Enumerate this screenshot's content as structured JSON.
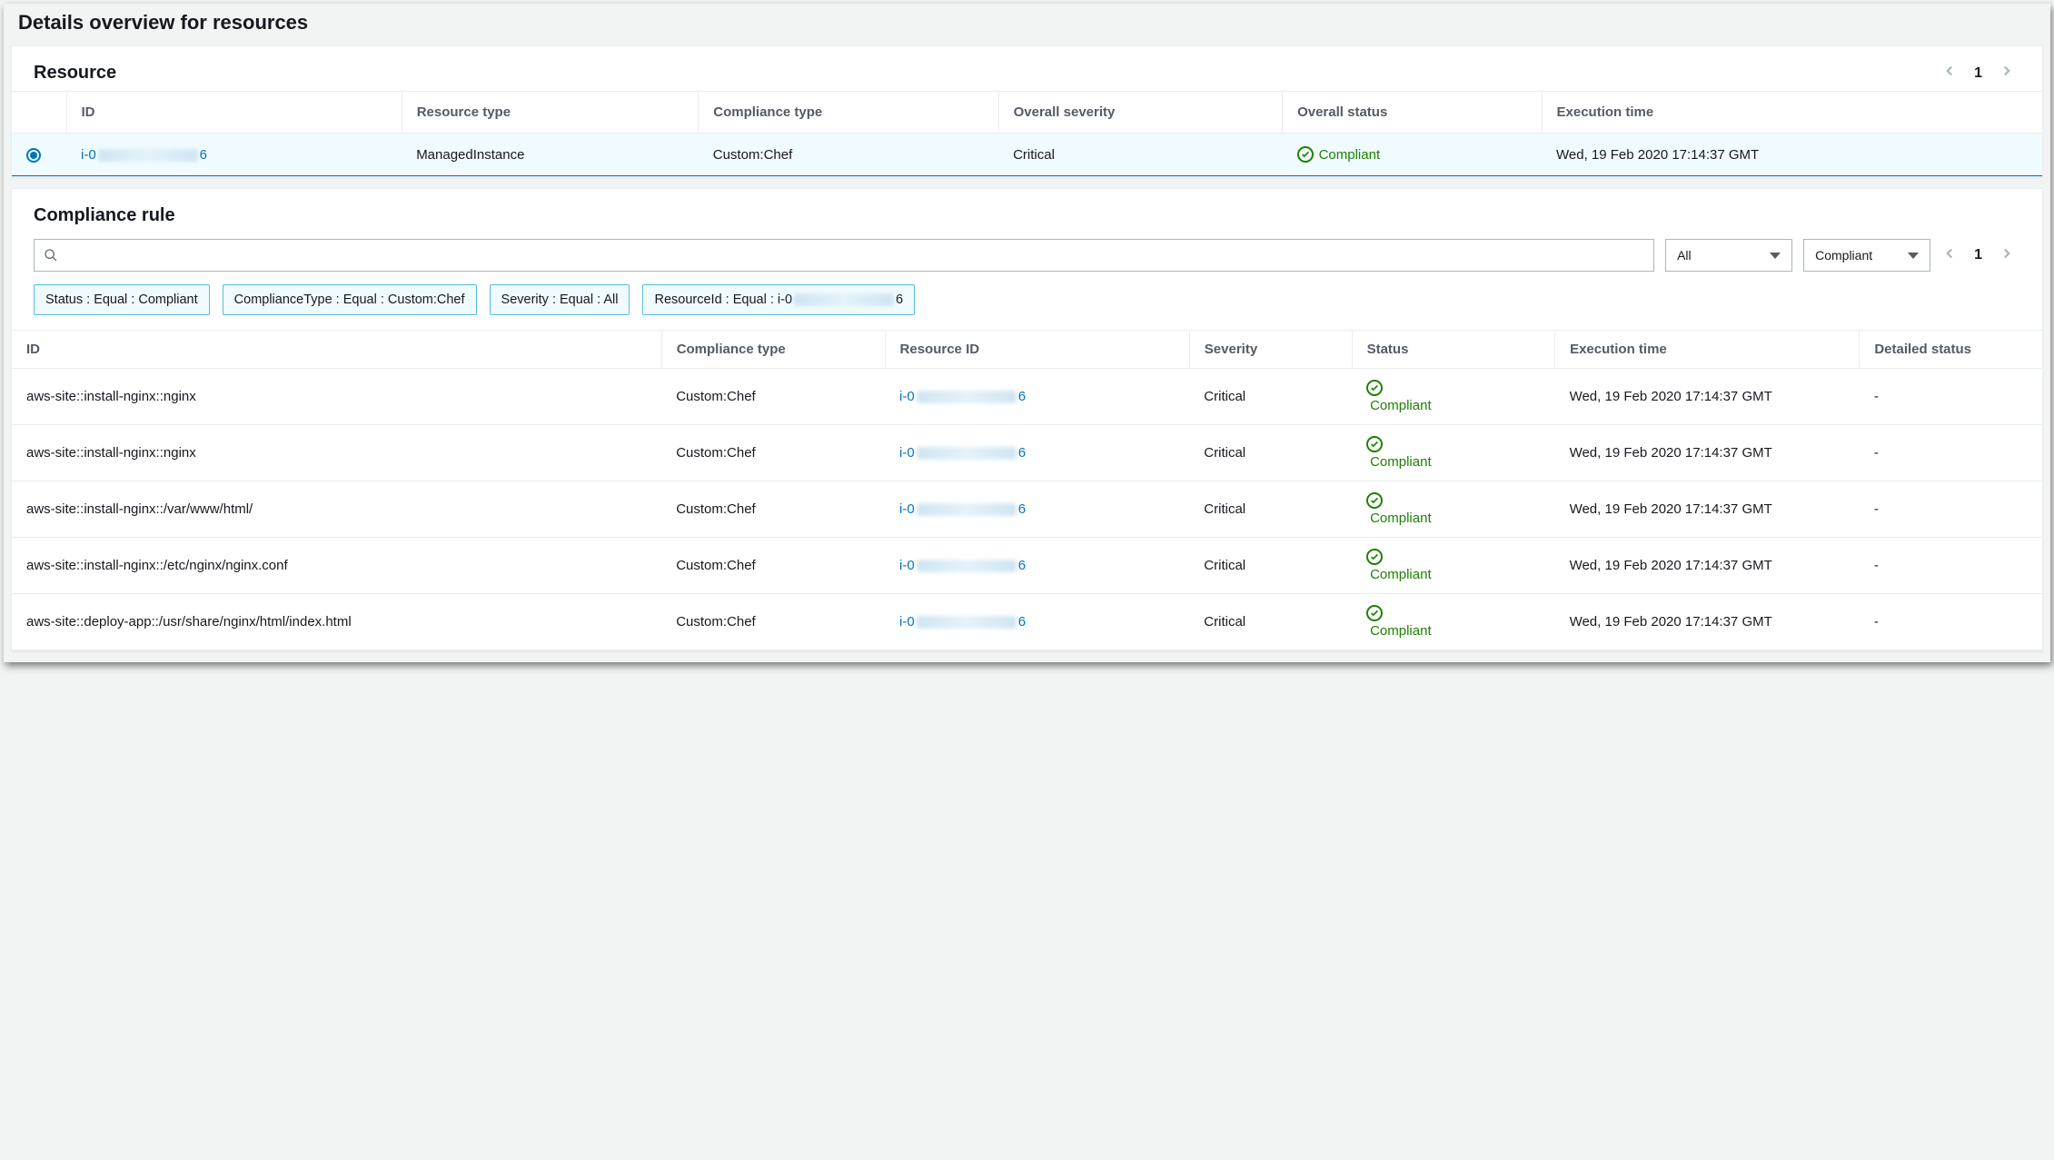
{
  "page_title": "Details overview for resources",
  "resource_panel": {
    "title": "Resource",
    "page": "1",
    "columns": {
      "id": "ID",
      "resource_type": "Resource type",
      "compliance_type": "Compliance type",
      "overall_severity": "Overall severity",
      "overall_status": "Overall status",
      "execution_time": "Execution time"
    },
    "row": {
      "id_prefix": "i-0",
      "id_suffix": "6",
      "resource_type": "ManagedInstance",
      "compliance_type": "Custom:Chef",
      "overall_severity": "Critical",
      "overall_status": "Compliant",
      "execution_time": "Wed, 19 Feb 2020 17:14:37 GMT"
    }
  },
  "rules_panel": {
    "title": "Compliance rule",
    "page": "1",
    "filter1": "All",
    "filter2": "Compliant",
    "chips": [
      "Status : Equal : Compliant",
      "ComplianceType : Equal : Custom:Chef",
      "Severity : Equal : All"
    ],
    "chip_resource_prefix": "ResourceId : Equal : i-0",
    "chip_resource_suffix": "6",
    "columns": {
      "id": "ID",
      "compliance_type": "Compliance type",
      "resource_id": "Resource ID",
      "severity": "Severity",
      "status": "Status",
      "execution_time": "Execution time",
      "detailed_status": "Detailed status"
    },
    "rows": [
      {
        "id": "aws-site::install-nginx::nginx",
        "compliance_type": "Custom:Chef",
        "rid_prefix": "i-0",
        "rid_suffix": "6",
        "severity": "Critical",
        "status": "Compliant",
        "execution_time": "Wed, 19 Feb 2020 17:14:37 GMT",
        "detailed_status": "-"
      },
      {
        "id": "aws-site::install-nginx::nginx",
        "compliance_type": "Custom:Chef",
        "rid_prefix": "i-0",
        "rid_suffix": "6",
        "severity": "Critical",
        "status": "Compliant",
        "execution_time": "Wed, 19 Feb 2020 17:14:37 GMT",
        "detailed_status": "-"
      },
      {
        "id": "aws-site::install-nginx::/var/www/html/",
        "compliance_type": "Custom:Chef",
        "rid_prefix": "i-0",
        "rid_suffix": "6",
        "severity": "Critical",
        "status": "Compliant",
        "execution_time": "Wed, 19 Feb 2020 17:14:37 GMT",
        "detailed_status": "-"
      },
      {
        "id": "aws-site::install-nginx::/etc/nginx/nginx.conf",
        "compliance_type": "Custom:Chef",
        "rid_prefix": "i-0",
        "rid_suffix": "6",
        "severity": "Critical",
        "status": "Compliant",
        "execution_time": "Wed, 19 Feb 2020 17:14:37 GMT",
        "detailed_status": "-"
      },
      {
        "id": "aws-site::deploy-app::/usr/share/nginx/html/index.html",
        "compliance_type": "Custom:Chef",
        "rid_prefix": "i-0",
        "rid_suffix": "6",
        "severity": "Critical",
        "status": "Compliant",
        "execution_time": "Wed, 19 Feb 2020 17:14:37 GMT",
        "detailed_status": "-"
      }
    ]
  }
}
